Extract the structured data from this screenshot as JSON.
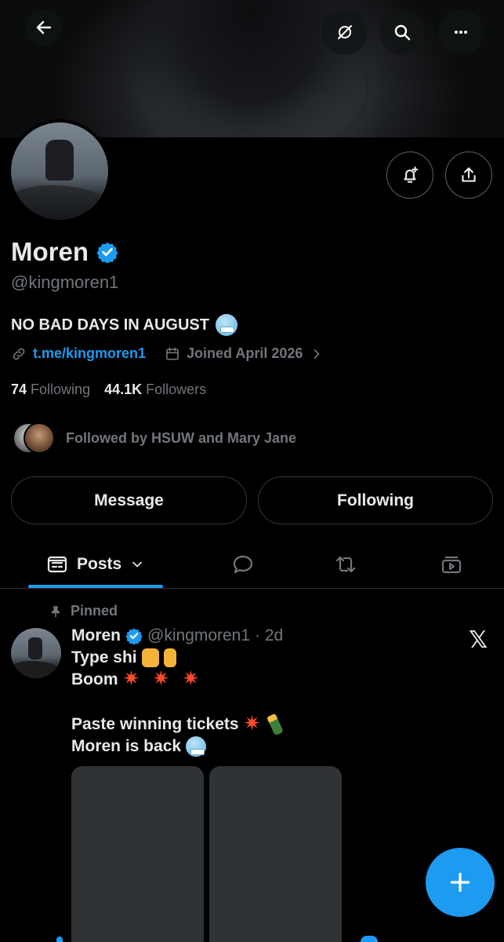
{
  "profile": {
    "name": "Moren",
    "handle": "@kingmoren1",
    "bio": "NO BAD DAYS IN AUGUST",
    "link": "t.me/kingmoren1",
    "joined": "Joined April 2026",
    "following_count": "74",
    "following_label": "Following",
    "followers_count": "44.1K",
    "followers_label": "Followers",
    "followed_by": "Followed by HSUW and Mary Jane"
  },
  "actions": {
    "message": "Message",
    "following": "Following"
  },
  "tabs": {
    "posts": "Posts"
  },
  "post": {
    "pinned_label": "Pinned",
    "author_name": "Moren",
    "author_handle": "@kingmoren1",
    "time": "· 2d",
    "line1": "Type shi",
    "line2": "Boom",
    "line3": "Paste winning tickets",
    "line4": "Moren is back"
  },
  "colors": {
    "accent": "#1d9bf0",
    "background": "#000000",
    "text_primary": "#e7e9ea",
    "text_secondary": "#71767b",
    "border": "#2f3336"
  },
  "icons": {
    "back": "arrow-left-icon",
    "grok": "grok-icon",
    "search": "search-icon",
    "more": "more-icon",
    "notify": "bell-plus-icon",
    "share": "share-icon",
    "verified": "verified-badge-icon",
    "link": "link-icon",
    "calendar": "calendar-icon",
    "chevron": "chevron-right-icon",
    "posts": "posts-tab-icon",
    "replies": "reply-bubble-icon",
    "reposts": "repost-icon",
    "video": "video-icon",
    "pin": "pin-icon",
    "x": "x-logo-icon",
    "compose": "plus-icon"
  }
}
